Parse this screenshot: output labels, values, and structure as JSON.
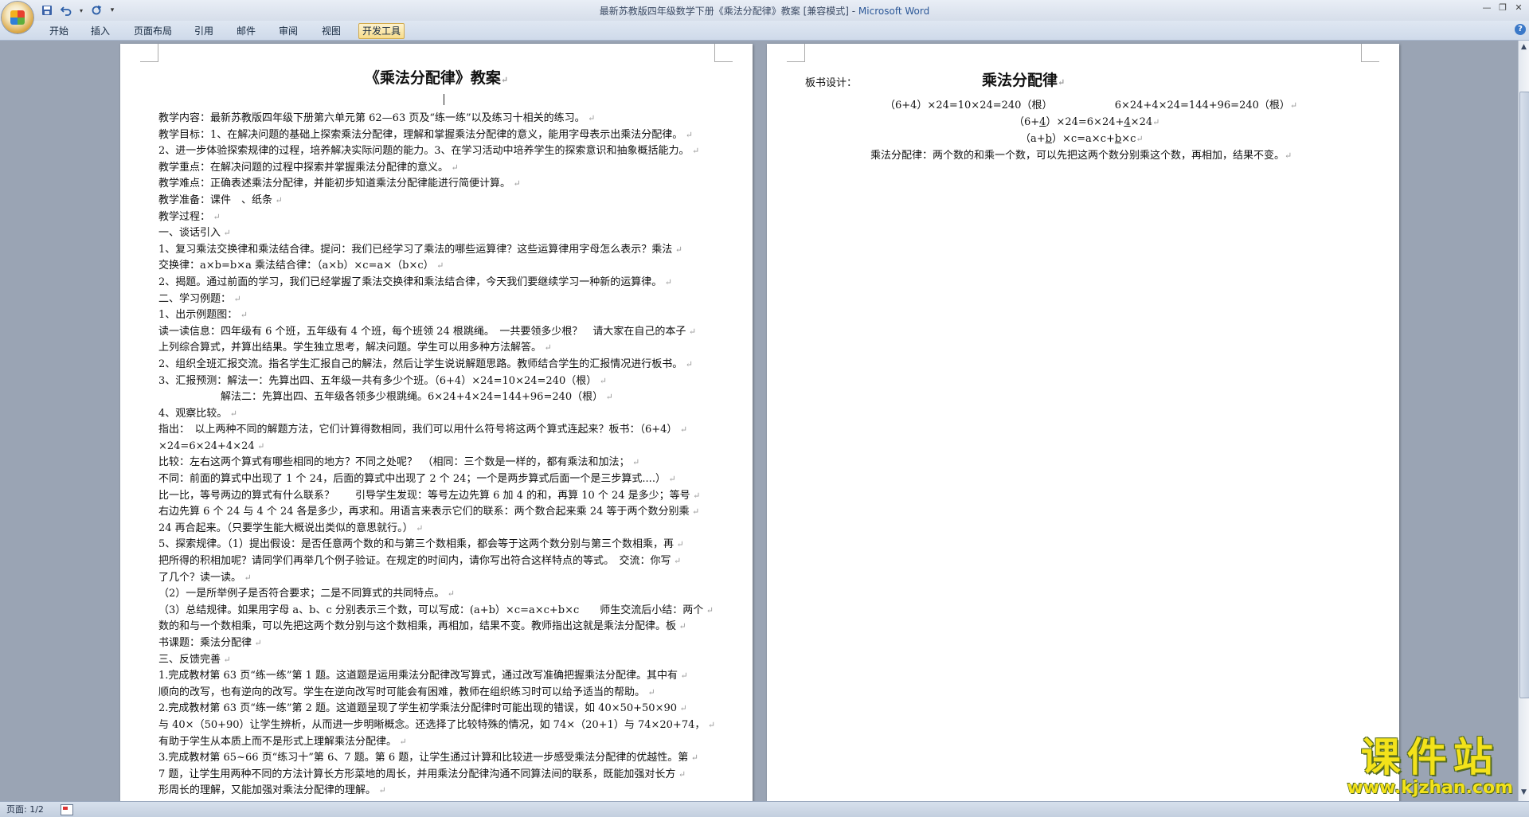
{
  "window": {
    "title_doc": "最新苏教版四年级数学下册《乘法分配律》教案 [兼容模式] - ",
    "title_app": "Microsoft Word"
  },
  "ribbon": {
    "tabs": [
      {
        "label": "开始",
        "active": false
      },
      {
        "label": "插入",
        "active": false
      },
      {
        "label": "页面布局",
        "active": false
      },
      {
        "label": "引用",
        "active": false
      },
      {
        "label": "邮件",
        "active": false
      },
      {
        "label": "审阅",
        "active": false
      },
      {
        "label": "视图",
        "active": false
      },
      {
        "label": "开发工具",
        "active": true
      }
    ]
  },
  "page1": {
    "title": "《乘法分配律》教案",
    "lines": [
      "教学内容：最新苏教版四年级下册第六单元第 62—63 页及“练一练”以及练习十相关的练习。",
      "教学目标：1、在解决问题的基础上探索乘法分配律，理解和掌握乘法分配律的意义，能用字母表示出乘法分配律。",
      "2、进一步体验探索规律的过程，培养解决实际问题的能力。3、在学习活动中培养学生的探索意识和抽象概括能力。",
      "教学重点：在解决问题的过程中探索并掌握乘法分配律的意义。",
      "教学难点：正确表述乘法分配律，并能初步知道乘法分配律能进行简便计算。",
      "教学准备：课件　、纸条",
      "教学过程：",
      " 一、谈话引入",
      "1、复习乘法交换律和乘法结合律。提问：我们已经学习了乘法的哪些运算律？这些运算律用字母怎么表示？乘法",
      "交换律：a×b=b×a 乘法结合律：（a×b）×c=a×（b×c）",
      "2、揭题。通过前面的学习，我们已经掌握了乘法交换律和乘法结合律，今天我们要继续学习一种新的运算律。",
      "二、学习例题：",
      "1、出示例题图：",
      "读一读信息：四年级有 6 个班，五年级有 4 个班，每个班领 24 根跳绳。　一共要领多少根？　请大家在自己的本子",
      "上列综合算式，并算出结果。学生独立思考，解决问题。学生可以用多种方法解答。",
      "2、组织全班汇报交流。指名学生汇报自己的解法，然后让学生说说解题思路。教师结合学生的汇报情况进行板书。",
      "3、汇报预测：解法一：先算出四、五年级一共有多少个班。（6+4）×24=10×24=240（根）",
      "　　　　　　解法二：先算出四、五年级各领多少根跳绳。6×24+4×24=144+96=240（根）",
      "4、观察比较。",
      "指出：　以上两种不同的解题方法，它们计算得数相同，我们可以用什么符号将这两个算式连起来？板书：（6+4）",
      "×24=6×24+4×24",
      "比较：左右这两个算式有哪些相同的地方？不同之处呢？　（相同：三个数是一样的，都有乘法和加法；",
      "不同：前面的算式中出现了 1 个 24，后面的算式中出现了 2 个 24；一个是两步算式后面一个是三步算式....）",
      "比一比，等号两边的算式有什么联系？　　引导学生发现：等号左边先算 6 加 4 的和，再算 10 个 24 是多少；等号",
      "右边先算 6 个 24 与 4 个 24 各是多少，再求和。用语言来表示它们的联系：两个数合起来乘 24 等于两个数分别乘",
      "24 再合起来。（只要学生能大概说出类似的意思就行。）",
      "5、探索规律。（1）提出假设：是否任意两个数的和与第三个数相乘，都会等于这两个数分别与第三个数相乘，再",
      "把所得的积相加呢？请同学们再举几个例子验证。在规定的时间内，请你写出符合这样特点的等式。　交流：你写",
      "了几个？读一读。",
      "（2）一是所举例子是否符合要求；二是不同算式的共同特点。",
      "（3）总结规律。如果用字母 a、b、c 分别表示三个数，可以写成：(a+b）×c=a×c+b×c　　师生交流后小结：两个",
      "数的和与一个数相乘，可以先把这两个数分别与这个数相乘，再相加，结果不变。教师指出这就是乘法分配律。板",
      "书课题：乘法分配律",
      "三、反馈完善",
      "1.完成教材第 63 页“练一练”第 1 题。这道题是运用乘法分配律改写算式，通过改写准确把握乘法分配律。其中有",
      "顺向的改写，也有逆向的改写。学生在逆向改写时可能会有困难，教师在组织练习时可以给予适当的帮助。",
      "2.完成教材第 63 页“练一练”第 2 题。这道题呈现了学生初学乘法分配律时可能出现的错误，如 40×50+50×90",
      "与 40×（50+90）让学生辨析，从而进一步明晰概念。还选择了比较特殊的情况，如 74×（20+1）与 74×20+74，",
      "有助于学生从本质上而不是形式上理解乘法分配律。",
      "3.完成教材第 65~66 页“练习十”第 6、7 题。第 6 题，让学生通过计算和比较进一步感受乘法分配律的优越性。第",
      "7 题，让学生用两种不同的方法计算长方形菜地的周长，并用乘法分配律沟通不同算法间的联系，既能加强对长方",
      "形周长的理解，又能加强对乘法分配律的理解。"
    ]
  },
  "page2": {
    "label": "板书设计：",
    "title": "乘法分配律",
    "eq1_left": "（6+4）×24=10×24=240（根）",
    "eq1_right": "6×24+4×24=144+96=240（根）",
    "eq2_a": "（6+",
    "eq2_b": "4",
    "eq2_c": "）×24=6×24+",
    "eq2_d": "4",
    "eq2_e": "×24",
    "eq3_a": "（a+",
    "eq3_b": "b",
    "eq3_c": "）×c=a×c+",
    "eq3_d": "b",
    "eq3_e": "×c",
    "rule": "乘法分配律：两个数的和乘一个数，可以先把这两个数分别乘这个数，再相加，结果不变。"
  },
  "statusbar": {
    "page": "页面: 1/2"
  },
  "watermark": {
    "main": "课件站",
    "url": "www.kjzhan.com"
  },
  "icons": [
    "office-button-icon",
    "save-icon",
    "undo-icon",
    "redo-icon",
    "customize-qat-icon",
    "minimize-icon",
    "restore-icon",
    "close-icon",
    "help-icon",
    "scroll-up-icon",
    "scroll-down-icon",
    "proofing-icon"
  ]
}
